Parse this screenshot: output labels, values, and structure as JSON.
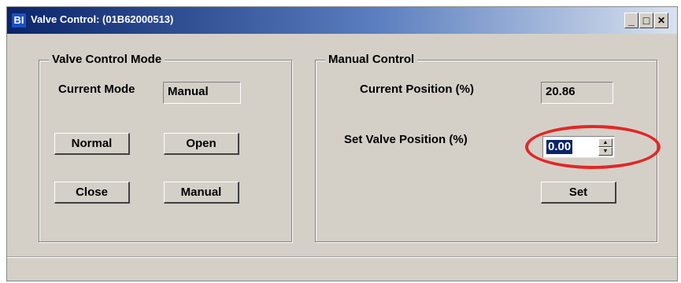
{
  "window": {
    "icon_text": "BI",
    "title": "Valve Control: (01B62000513)",
    "minimize_label": "_",
    "maximize_label": "□",
    "close_label": "✕"
  },
  "mode_group": {
    "title": "Valve Control Mode",
    "current_mode_label": "Current Mode",
    "current_mode_value": "Manual",
    "buttons": {
      "normal": "Normal",
      "open": "Open",
      "close": "Close",
      "manual": "Manual"
    }
  },
  "manual_group": {
    "title": "Manual Control",
    "current_position_label": "Current Position (%)",
    "current_position_value": "20.86",
    "set_position_label": "Set Valve Position (%)",
    "set_position_value": "0.00",
    "set_button": "Set"
  },
  "highlight": {
    "color": "#e32626"
  }
}
